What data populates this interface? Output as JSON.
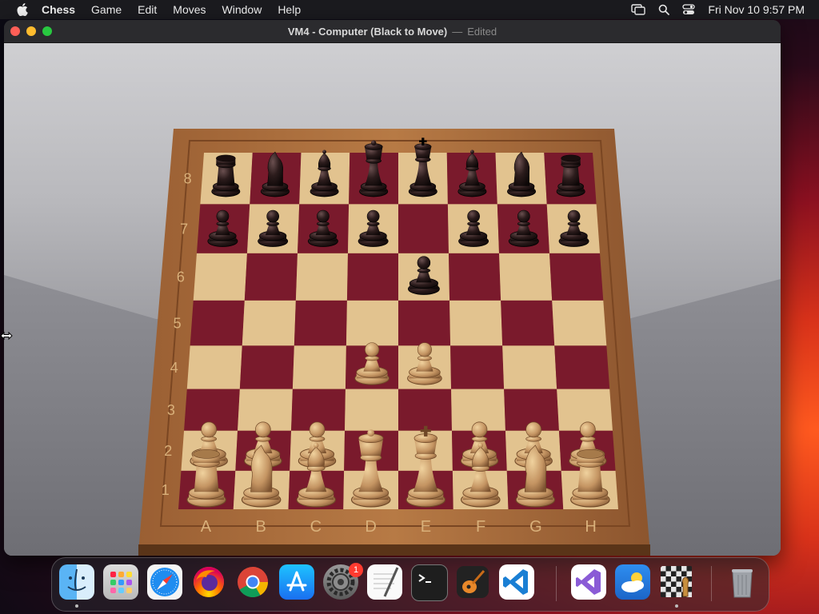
{
  "menubar": {
    "app_name": "Chess",
    "menus": [
      "Game",
      "Edit",
      "Moves",
      "Window",
      "Help"
    ],
    "clock": "Fri Nov 10  9:57 PM",
    "status_icons": [
      "display-mirroring-icon",
      "spotlight-search-icon",
      "control-center-icon"
    ]
  },
  "window": {
    "title": "VM4 - Computer  (Black to Move)",
    "separator": "—",
    "edited_label": "Edited"
  },
  "board": {
    "ranks": [
      "8",
      "7",
      "6",
      "5",
      "4",
      "3",
      "2",
      "1"
    ],
    "files": [
      "A",
      "B",
      "C",
      "D",
      "E",
      "F",
      "G",
      "H"
    ],
    "colors": {
      "light_square": "#e2c38f",
      "dark_square": "#7a1a2c",
      "frame": "#a76b3b",
      "white_piece": "#c9a06a",
      "black_piece": "#2a1a1a"
    },
    "pieces": [
      {
        "square": "a8",
        "piece": "rook",
        "color": "black"
      },
      {
        "square": "b8",
        "piece": "knight",
        "color": "black"
      },
      {
        "square": "c8",
        "piece": "bishop",
        "color": "black"
      },
      {
        "square": "d8",
        "piece": "queen",
        "color": "black"
      },
      {
        "square": "e8",
        "piece": "king",
        "color": "black"
      },
      {
        "square": "f8",
        "piece": "bishop",
        "color": "black"
      },
      {
        "square": "g8",
        "piece": "knight",
        "color": "black"
      },
      {
        "square": "h8",
        "piece": "rook",
        "color": "black"
      },
      {
        "square": "a7",
        "piece": "pawn",
        "color": "black"
      },
      {
        "square": "b7",
        "piece": "pawn",
        "color": "black"
      },
      {
        "square": "c7",
        "piece": "pawn",
        "color": "black"
      },
      {
        "square": "d7",
        "piece": "pawn",
        "color": "black"
      },
      {
        "square": "f7",
        "piece": "pawn",
        "color": "black"
      },
      {
        "square": "g7",
        "piece": "pawn",
        "color": "black"
      },
      {
        "square": "h7",
        "piece": "pawn",
        "color": "black"
      },
      {
        "square": "e6",
        "piece": "pawn",
        "color": "black"
      },
      {
        "square": "d4",
        "piece": "pawn",
        "color": "white"
      },
      {
        "square": "e4",
        "piece": "pawn",
        "color": "white"
      },
      {
        "square": "a2",
        "piece": "pawn",
        "color": "white"
      },
      {
        "square": "b2",
        "piece": "pawn",
        "color": "white"
      },
      {
        "square": "c2",
        "piece": "pawn",
        "color": "white"
      },
      {
        "square": "f2",
        "piece": "pawn",
        "color": "white"
      },
      {
        "square": "g2",
        "piece": "pawn",
        "color": "white"
      },
      {
        "square": "h2",
        "piece": "pawn",
        "color": "white"
      },
      {
        "square": "a1",
        "piece": "rook",
        "color": "white"
      },
      {
        "square": "b1",
        "piece": "knight",
        "color": "white"
      },
      {
        "square": "c1",
        "piece": "bishop",
        "color": "white"
      },
      {
        "square": "d1",
        "piece": "queen",
        "color": "white"
      },
      {
        "square": "e1",
        "piece": "king",
        "color": "white"
      },
      {
        "square": "f1",
        "piece": "bishop",
        "color": "white"
      },
      {
        "square": "g1",
        "piece": "knight",
        "color": "white"
      },
      {
        "square": "h1",
        "piece": "rook",
        "color": "white"
      }
    ]
  },
  "dock": {
    "apps": [
      {
        "name": "finder-icon",
        "running": true
      },
      {
        "name": "launchpad-icon",
        "running": false
      },
      {
        "name": "safari-icon",
        "running": false
      },
      {
        "name": "firefox-icon",
        "running": false
      },
      {
        "name": "chrome-icon",
        "running": false
      },
      {
        "name": "app-store-icon",
        "running": false
      },
      {
        "name": "system-settings-icon",
        "running": false,
        "badge": "1"
      },
      {
        "name": "textedit-icon",
        "running": false
      },
      {
        "name": "terminal-icon",
        "running": false
      },
      {
        "name": "garageband-icon",
        "running": false
      },
      {
        "name": "vscode-icon",
        "running": false
      },
      {
        "name": "visual-studio-icon",
        "running": false
      },
      {
        "name": "weather-icon",
        "running": false
      },
      {
        "name": "chess-icon",
        "running": true
      },
      {
        "name": "trash-icon",
        "running": false
      }
    ],
    "settings_badge": "1"
  }
}
